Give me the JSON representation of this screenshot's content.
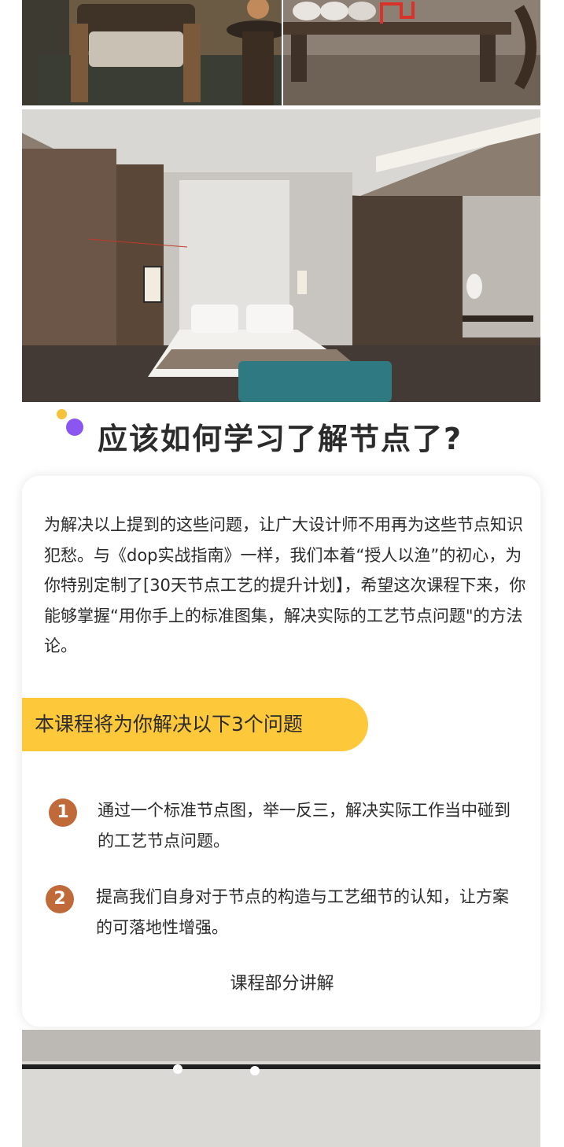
{
  "heading": "应该如何学习了解节点了?",
  "intro": "为解决以上提到的这些问题，让广大设计师不用再为这些节点知识犯愁。与《dop实战指南》一样，我们本着“授人以渔”的初心，为你特别定制了[30天节点工艺的提升计划】，希望这次课程下来，你能够掌握“用你手上的标准图集，解决实际的工艺节点问题\"的方法论。",
  "banner": "本课程将为你解决以下3个问题",
  "items": [
    {
      "number": "1",
      "text": "通过一个标准节点图，举一反三，解决实际工作当中碰到的工艺节点问题。"
    },
    {
      "number": "2",
      "text": "提高我们自身对于节点的构造与工艺细节的认知，让方案的可落地性增强。"
    }
  ],
  "caption": "课程部分讲解"
}
